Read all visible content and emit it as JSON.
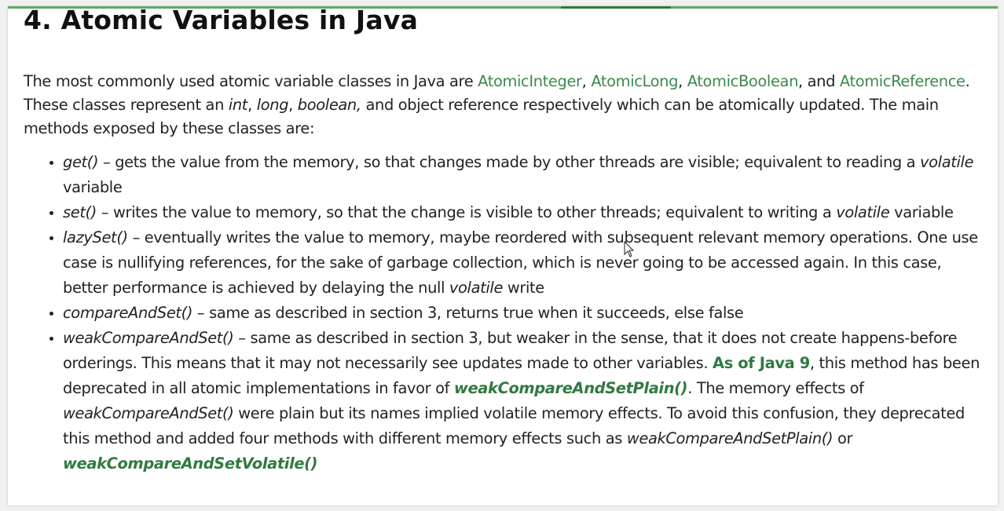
{
  "heading": "4. Atomic Variables in Java",
  "intro": {
    "t1": "The most commonly used atomic variable classes in Java are ",
    "link1": "AtomicInteger",
    "t2": ", ",
    "link2": "AtomicLong",
    "t3": ", ",
    "link3": "AtomicBoolean",
    "t4": ", and ",
    "link4": "AtomicReference",
    "t5": ". These classes represent an ",
    "em1": "int",
    "t6": ", ",
    "em2": "long",
    "t7": ", ",
    "em3": "boolean,",
    "t8": " and object reference respectively which can be atomically updated. The main methods exposed by these classes are:"
  },
  "items": [
    {
      "method": "get()",
      "t1": " – gets the value from the memory, so that changes made by other threads are visible; equivalent to reading a ",
      "em1": "volatile",
      "t2": " variable"
    },
    {
      "method": "set()",
      "t1": " – writes the value to memory, so that the change is visible to other threads; equivalent to writing a ",
      "em1": "volatile",
      "t2": " variable"
    },
    {
      "method": "lazySet()",
      "t1": " – eventually writes the value to memory, maybe reordered with subsequent relevant memory operations. One use case is nullifying references, for the sake of garbage collection, which is never going to be accessed again. In this case, better performance is achieved by delaying the null ",
      "em1": "volatile",
      "t2": " write"
    },
    {
      "method": "compareAndSet()",
      "t1": " – same as described in section 3, returns true when it succeeds, else false"
    },
    {
      "method": "weakCompareAndSet()",
      "t1": " – same as described in section 3, but weaker in the sense, that it does not create happens-before orderings. This means that it may not necessarily see updates made to other variables. ",
      "link1": "As of Java 9",
      "t2": ", this method has been deprecated in all atomic implementations in favor of ",
      "link2": "weakCompareAndSetPlain()",
      "t3": ". The memory effects of ",
      "em1": "weakCompareAndSet()",
      "t4": " were plain but its names implied volatile memory effects. To avoid this confusion, they deprecated this method and added four methods with different memory effects such as ",
      "em2": "weakCompareAndSetPlain()",
      "t5": " or ",
      "link3": "weakCompareAndSetVolatile()"
    }
  ],
  "colors": {
    "link": "#3b8a4d",
    "strong_link": "#2f7a40",
    "progress": "#5dab6f"
  }
}
